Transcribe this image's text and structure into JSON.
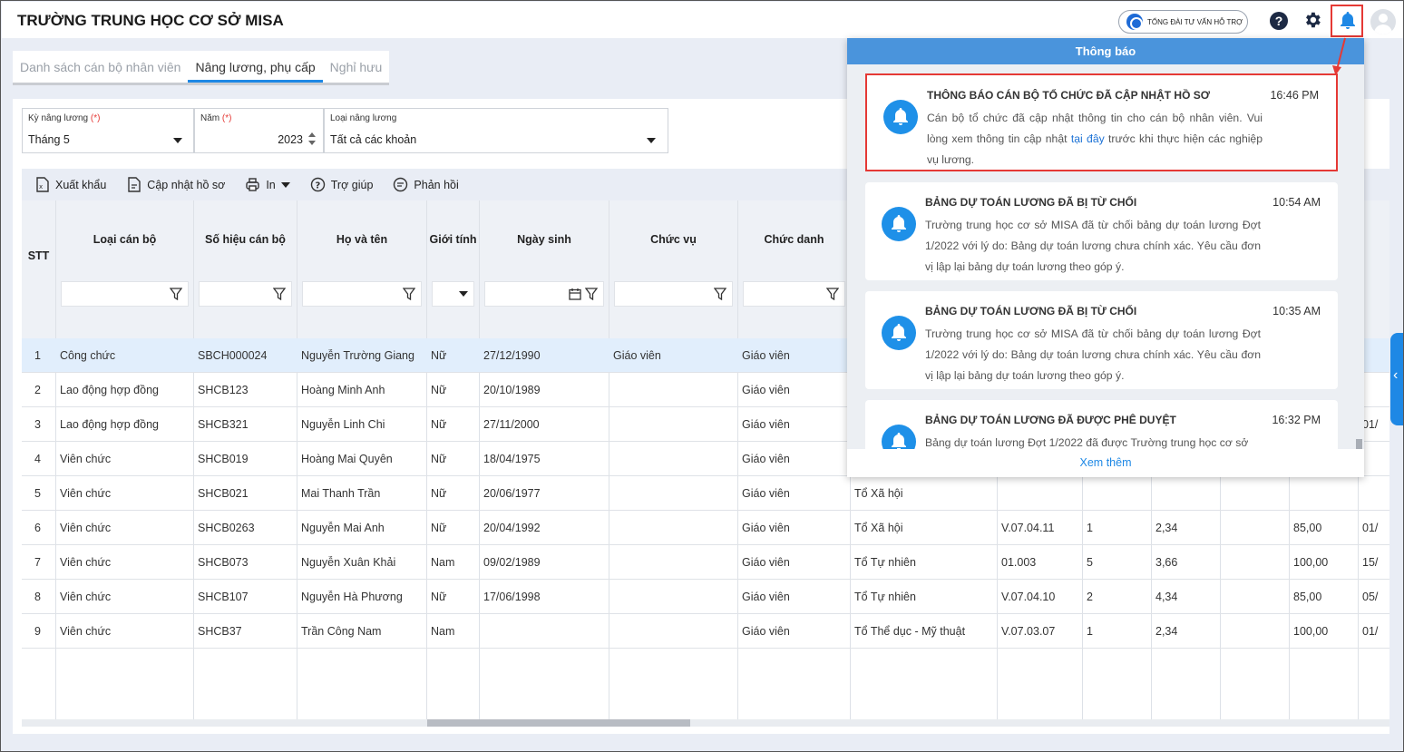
{
  "header": {
    "title": "TRƯỜNG TRUNG HỌC CƠ SỞ MISA",
    "hotline_label": "TỔNG ĐÀI TƯ VẤN HỖ TRỢ"
  },
  "tabs": [
    {
      "label": "Danh sách cán bộ nhân viên",
      "active": false
    },
    {
      "label": "Nâng lương, phụ cấp",
      "active": true
    },
    {
      "label": "Nghỉ hưu",
      "active": false
    }
  ],
  "filters": {
    "period": {
      "label": "Kỳ nâng lương",
      "required": "(*)",
      "value": "Tháng 5"
    },
    "year": {
      "label": "Năm",
      "required": "(*)",
      "value": "2023"
    },
    "type": {
      "label": "Loại nâng lương",
      "value": "Tất cả các khoản"
    }
  },
  "toolbar": {
    "export": "Xuất khẩu",
    "update": "Cập nhật hồ sơ",
    "print": "In",
    "help": "Trợ giúp",
    "feedback": "Phản hồi"
  },
  "table": {
    "columns": [
      "STT",
      "Loại cán bộ",
      "Số hiệu cán bộ",
      "Họ và tên",
      "Giới tính",
      "Ngày sinh",
      "Chức vụ",
      "Chức danh"
    ],
    "rows": [
      {
        "stt": "1",
        "type": "Công chức",
        "code": "SBCH000024",
        "name": "Nguyễn Trường Giang",
        "gender": "Nữ",
        "dob": "27/12/1990",
        "position": "Giáo viên",
        "title": "Giáo viên",
        "group": "",
        "grade": "",
        "step": "",
        "coef": "",
        "pct": "",
        "date": ""
      },
      {
        "stt": "2",
        "type": "Lao động hợp đồng",
        "code": "SHCB123",
        "name": "Hoàng Minh Anh",
        "gender": "Nữ",
        "dob": "20/10/1989",
        "position": "",
        "title": "Giáo viên",
        "group": "",
        "grade": "",
        "step": "",
        "coef": "",
        "pct": "",
        "date": ""
      },
      {
        "stt": "3",
        "type": "Lao động hợp đồng",
        "code": "SHCB321",
        "name": "Nguyễn Linh Chi",
        "gender": "Nữ",
        "dob": "27/11/2000",
        "position": "",
        "title": "Giáo viên",
        "group": "",
        "grade": "",
        "step": "",
        "coef": "",
        "pct": "",
        "date": "01/"
      },
      {
        "stt": "4",
        "type": "Viên chức",
        "code": "SHCB019",
        "name": "Hoàng Mai Quyên",
        "gender": "Nữ",
        "dob": "18/04/1975",
        "position": "",
        "title": "Giáo viên",
        "group": "",
        "grade": "",
        "step": "",
        "coef": "",
        "pct": "",
        "date": ""
      },
      {
        "stt": "5",
        "type": "Viên chức",
        "code": "SHCB021",
        "name": "Mai Thanh Trần",
        "gender": "Nữ",
        "dob": "20/06/1977",
        "position": "",
        "title": "Giáo viên",
        "group": "Tổ Xã hội",
        "grade": "",
        "step": "",
        "coef": "",
        "pct": "",
        "date": ""
      },
      {
        "stt": "6",
        "type": "Viên chức",
        "code": "SHCB0263",
        "name": "Nguyễn Mai Anh",
        "gender": "Nữ",
        "dob": "20/04/1992",
        "position": "",
        "title": "Giáo viên",
        "group": "Tổ Xã hội",
        "grade": "V.07.04.11",
        "step": "1",
        "coef": "2,34",
        "pct": "85,00",
        "date": "01/"
      },
      {
        "stt": "7",
        "type": "Viên chức",
        "code": "SHCB073",
        "name": "Nguyễn Xuân Khải",
        "gender": "Nam",
        "dob": "09/02/1989",
        "position": "",
        "title": "Giáo viên",
        "group": "Tổ Tự nhiên",
        "grade": "01.003",
        "step": "5",
        "coef": "3,66",
        "pct": "100,00",
        "date": "15/"
      },
      {
        "stt": "8",
        "type": "Viên chức",
        "code": "SHCB107",
        "name": "Nguyễn Hà Phương",
        "gender": "Nữ",
        "dob": "17/06/1998",
        "position": "",
        "title": "Giáo viên",
        "group": "Tổ Tự nhiên",
        "grade": "V.07.04.10",
        "step": "2",
        "coef": "4,34",
        "pct": "85,00",
        "date": "05/"
      },
      {
        "stt": "9",
        "type": "Viên chức",
        "code": "SHCB37",
        "name": "Trần Công Nam",
        "gender": "Nam",
        "dob": "",
        "position": "",
        "title": "Giáo viên",
        "group": "Tổ Thể dục - Mỹ thuật",
        "grade": "V.07.03.07",
        "step": "1",
        "coef": "2,34",
        "pct": "100,00",
        "date": "01/"
      }
    ]
  },
  "notifications": {
    "header": "Thông báo",
    "more": "Xem thêm",
    "items": [
      {
        "title": "THÔNG BÁO CÁN BỘ TỔ CHỨC ĐÃ CẬP NHẬT HỒ SƠ",
        "time": "16:46 PM",
        "text_before": "Cán bộ tổ chức đã cập nhật thông tin cho cán bộ nhân viên. Vui lòng xem thông tin cập nhật ",
        "link": "tại đây",
        "text_after": " trước khi thực hiện các nghiệp vụ lương."
      },
      {
        "title": "BẢNG DỰ TOÁN LƯƠNG ĐÃ BỊ TỪ CHỐI",
        "time": "10:54 AM",
        "text": "Trường trung học cơ sở MISA đã từ chối bảng dự toán lương Đợt 1/2022 với lý do: Bảng dự toán lương chưa chính xác. Yêu cầu đơn vị lập lại bảng dự toán lương theo góp ý."
      },
      {
        "title": "BẢNG DỰ TOÁN LƯƠNG ĐÃ BỊ TỪ CHỐI",
        "time": "10:35 AM",
        "text": "Trường trung học cơ sở MISA đã từ chối bảng dự toán lương Đợt 1/2022 với lý do: Bảng dự toán lương chưa chính xác. Yêu cầu đơn vị lập lại bảng dự toán lương theo góp ý."
      },
      {
        "title": "BẢNG DỰ TOÁN LƯƠNG ĐÃ ĐƯỢC PHÊ DUYỆT",
        "time": "16:32 PM",
        "text": "Bảng dự toán lương Đợt 1/2022 đã được Trường trung học cơ sở"
      }
    ]
  },
  "colors": {
    "accent": "#1e88e5",
    "highlight": "#e53935",
    "selected_row": "#e1eefc"
  }
}
